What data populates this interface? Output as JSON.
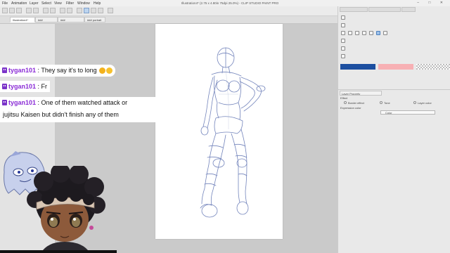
{
  "window": {
    "title": "Illustration4* (2.75 x 4.80in 75dpi 25.0%) - CLIP STUDIO PAINT PRO",
    "controls": "–  □  ✕"
  },
  "menu": [
    "File",
    "Animation",
    "Layer",
    "Select",
    "View",
    "Filter",
    "Window",
    "Help"
  ],
  "tabs": [
    {
      "label": "Illustration4*",
      "active": true
    },
    {
      "label": "###",
      "active": false
    },
    {
      "label": "###",
      "active": false
    },
    {
      "label": "### portrait",
      "active": false
    }
  ],
  "right_panel": {
    "color_swatches": {
      "main": "#1c4fa0",
      "sub": "#f7b0b4"
    },
    "layer_property_tab": "Layer Property",
    "effect_label": "Effect",
    "border_effect": "Border effect",
    "tone": "Tone",
    "layer_color": "Layer color",
    "expression_color_label": "Expression color",
    "expression_color_value": "Color"
  },
  "chat": [
    {
      "user": "tygan101",
      "message": " : They say it's to long "
    },
    {
      "user": "tygan101",
      "message": " : Fr"
    },
    {
      "user": "tygan101",
      "message": " : One of them watched attack or",
      "continuation": "jujitsu Kaisen but didn't finish any of them"
    }
  ],
  "icons": {
    "twitch_badge": "twitch-badge-icon",
    "emoji_thumb": "thumbs-up-emoji-icon",
    "emoji_grin": "grinning-emoji-icon"
  }
}
